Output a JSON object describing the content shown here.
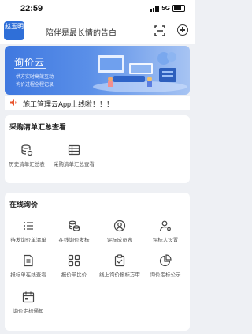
{
  "status_bar": {
    "time": "22:59",
    "network": "5G"
  },
  "header": {
    "avatar_text": "赵玉明",
    "title": "陪伴是最长情的告白",
    "scan_icon": "scan-icon",
    "add_icon": "plus-circle-icon"
  },
  "banner": {
    "title": "询价云",
    "subtitle_1": "供方实时高效互动",
    "subtitle_2": "询价过程全程记录"
  },
  "notice": {
    "icon": "speaker-icon",
    "text": "施工管理云App上线啦！！！"
  },
  "purchase_summary": {
    "title": "采购清单汇总查看",
    "items": [
      {
        "label": "历史清单汇总表",
        "icon": "database-icon"
      },
      {
        "label": "采购清单汇总查看",
        "icon": "table-icon"
      }
    ]
  },
  "online_inquiry": {
    "title": "在线询价",
    "items": [
      {
        "label": "待发询价单清单",
        "icon": "list-icon"
      },
      {
        "label": "在线询价发标",
        "icon": "coins-icon"
      },
      {
        "label": "评标成员表",
        "icon": "user-circle-icon"
      },
      {
        "label": "评标人设置",
        "icon": "user-settings-icon"
      },
      {
        "label": "报标单在线查看",
        "icon": "document-icon"
      },
      {
        "label": "报价单比价",
        "icon": "grid-icon"
      },
      {
        "label": "线上询价报标方审",
        "icon": "clipboard-icon"
      },
      {
        "label": "询价定标公示",
        "icon": "pie-chart-icon"
      },
      {
        "label": "询价定标通知",
        "icon": "calendar-icon"
      }
    ]
  }
}
